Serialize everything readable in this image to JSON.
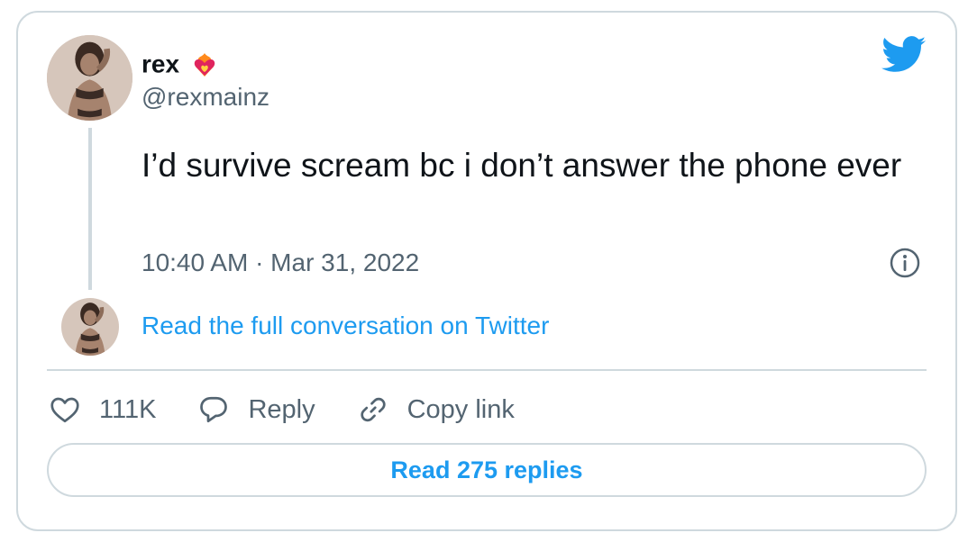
{
  "author": {
    "display_name": "rex",
    "handle": "@rexmainz",
    "name_emoji": "heart-on-fire-icon"
  },
  "tweet": {
    "text": "I’d survive scream bc i don’t answer the phone ever",
    "timestamp": "10:40 AM · Mar 31, 2022"
  },
  "conversation_link": "Read the full conversation on Twitter",
  "actions": {
    "like_count": "111K",
    "reply_label": "Reply",
    "copy_link_label": "Copy link"
  },
  "read_replies_label": "Read 275 replies",
  "colors": {
    "accent": "#1d9bf0",
    "muted_text": "#536471",
    "border": "#cfd9de",
    "like_heart_emoji": "#e0245e"
  }
}
